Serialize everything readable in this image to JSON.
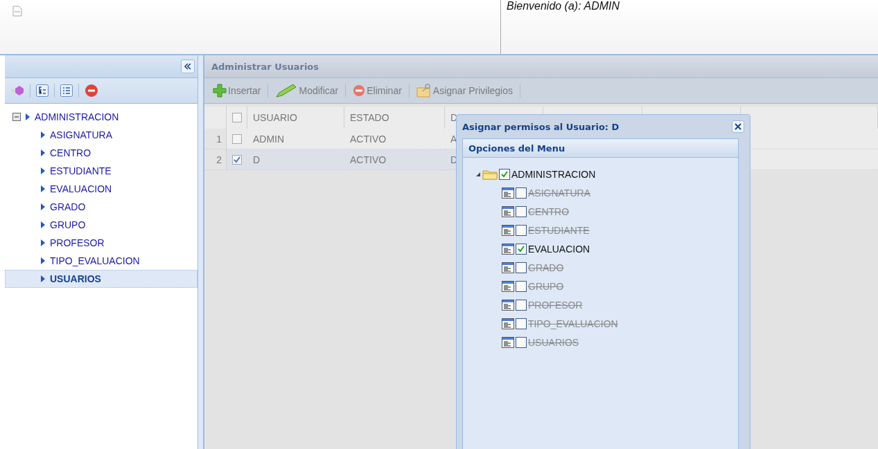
{
  "header": {
    "welcome": "Bienvenido (a): ADMIN"
  },
  "sidebar": {
    "tree": [
      {
        "label": "ADMINISTRACION",
        "expanded": true,
        "selected": false,
        "children": [
          {
            "label": "ASIGNATURA",
            "selected": false
          },
          {
            "label": "CENTRO",
            "selected": false
          },
          {
            "label": "ESTUDIANTE",
            "selected": false
          },
          {
            "label": "EVALUACION",
            "selected": false
          },
          {
            "label": "GRADO",
            "selected": false
          },
          {
            "label": "GRUPO",
            "selected": false
          },
          {
            "label": "PROFESOR",
            "selected": false
          },
          {
            "label": "TIPO_EVALUACION",
            "selected": false
          },
          {
            "label": "USUARIOS",
            "selected": true
          }
        ]
      }
    ]
  },
  "main": {
    "title": "Administrar Usuarios",
    "toolbar": [
      {
        "kind": "insert",
        "label": "Insertar"
      },
      {
        "kind": "edit",
        "label": "Modificar"
      },
      {
        "kind": "delete",
        "label": "Eliminar"
      },
      {
        "kind": "privileges",
        "label": "Asignar Privilegios"
      }
    ],
    "table": {
      "select_all": {
        "checked": false
      },
      "columns": [
        "USUARIO",
        "ESTADO",
        "D"
      ],
      "rows": [
        {
          "number": "1",
          "selected": false,
          "cells": [
            "ADMIN",
            "ACTIVO",
            "A"
          ]
        },
        {
          "number": "2",
          "selected": true,
          "cells": [
            "D",
            "ACTIVO",
            "D"
          ]
        }
      ]
    }
  },
  "dialog": {
    "title": "Asignar permisos al Usuario: D",
    "panel_title": "Opciones del Menu",
    "tree": [
      {
        "label": "ADMINISTRACION",
        "checked": true,
        "expanded": true,
        "children": [
          {
            "label": "ASIGNATURA",
            "checked": false
          },
          {
            "label": "CENTRO",
            "checked": false
          },
          {
            "label": "ESTUDIANTE",
            "checked": false
          },
          {
            "label": "EVALUACION",
            "checked": true
          },
          {
            "label": "GRADO",
            "checked": false
          },
          {
            "label": "GRUPO",
            "checked": false
          },
          {
            "label": "PROFESOR",
            "checked": false
          },
          {
            "label": "TIPO_EVALUACION",
            "checked": false
          },
          {
            "label": "USUARIOS",
            "checked": false
          }
        ]
      }
    ]
  }
}
